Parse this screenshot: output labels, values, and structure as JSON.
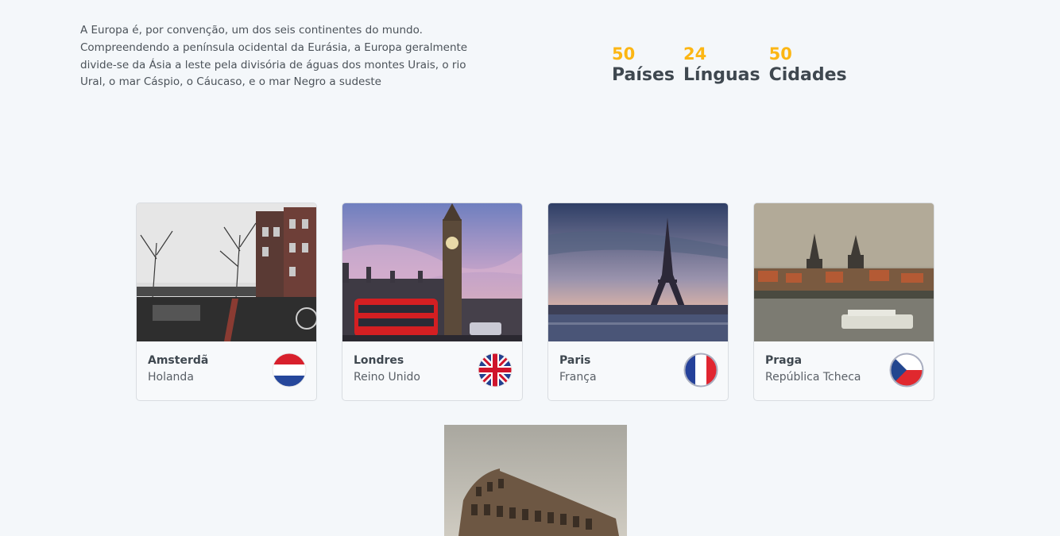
{
  "intro": {
    "text": "A Europa é, por convenção, um dos seis continentes do mundo. Compreendendo a península ocidental da Eurásia, a Europa geralmente divide-se da Ásia a leste pela divisória de águas dos montes Urais, o rio Ural, o mar Cáspio, o Cáucaso, e o mar Negro a sudeste"
  },
  "stats": [
    {
      "value": "50",
      "label": "Países"
    },
    {
      "value": "24",
      "label": "Línguas"
    },
    {
      "value": "50",
      "label": "Cidades"
    }
  ],
  "colors": {
    "accent": "#fcb614",
    "heading": "#3f4850",
    "background": "#f4f7fa"
  },
  "cities": [
    {
      "city": "Amsterdã",
      "country": "Holanda",
      "flag": "netherlands-flag",
      "photo": "amsterdam-canal-photo"
    },
    {
      "city": "Londres",
      "country": "Reino Unido",
      "flag": "uk-flag",
      "photo": "london-big-ben-photo"
    },
    {
      "city": "Paris",
      "country": "França",
      "flag": "france-flag",
      "photo": "paris-eiffel-tower-photo"
    },
    {
      "city": "Praga",
      "country": "República Tcheca",
      "flag": "czech-flag",
      "photo": "prague-old-town-photo"
    },
    {
      "photo": "rome-colosseum-photo"
    }
  ]
}
